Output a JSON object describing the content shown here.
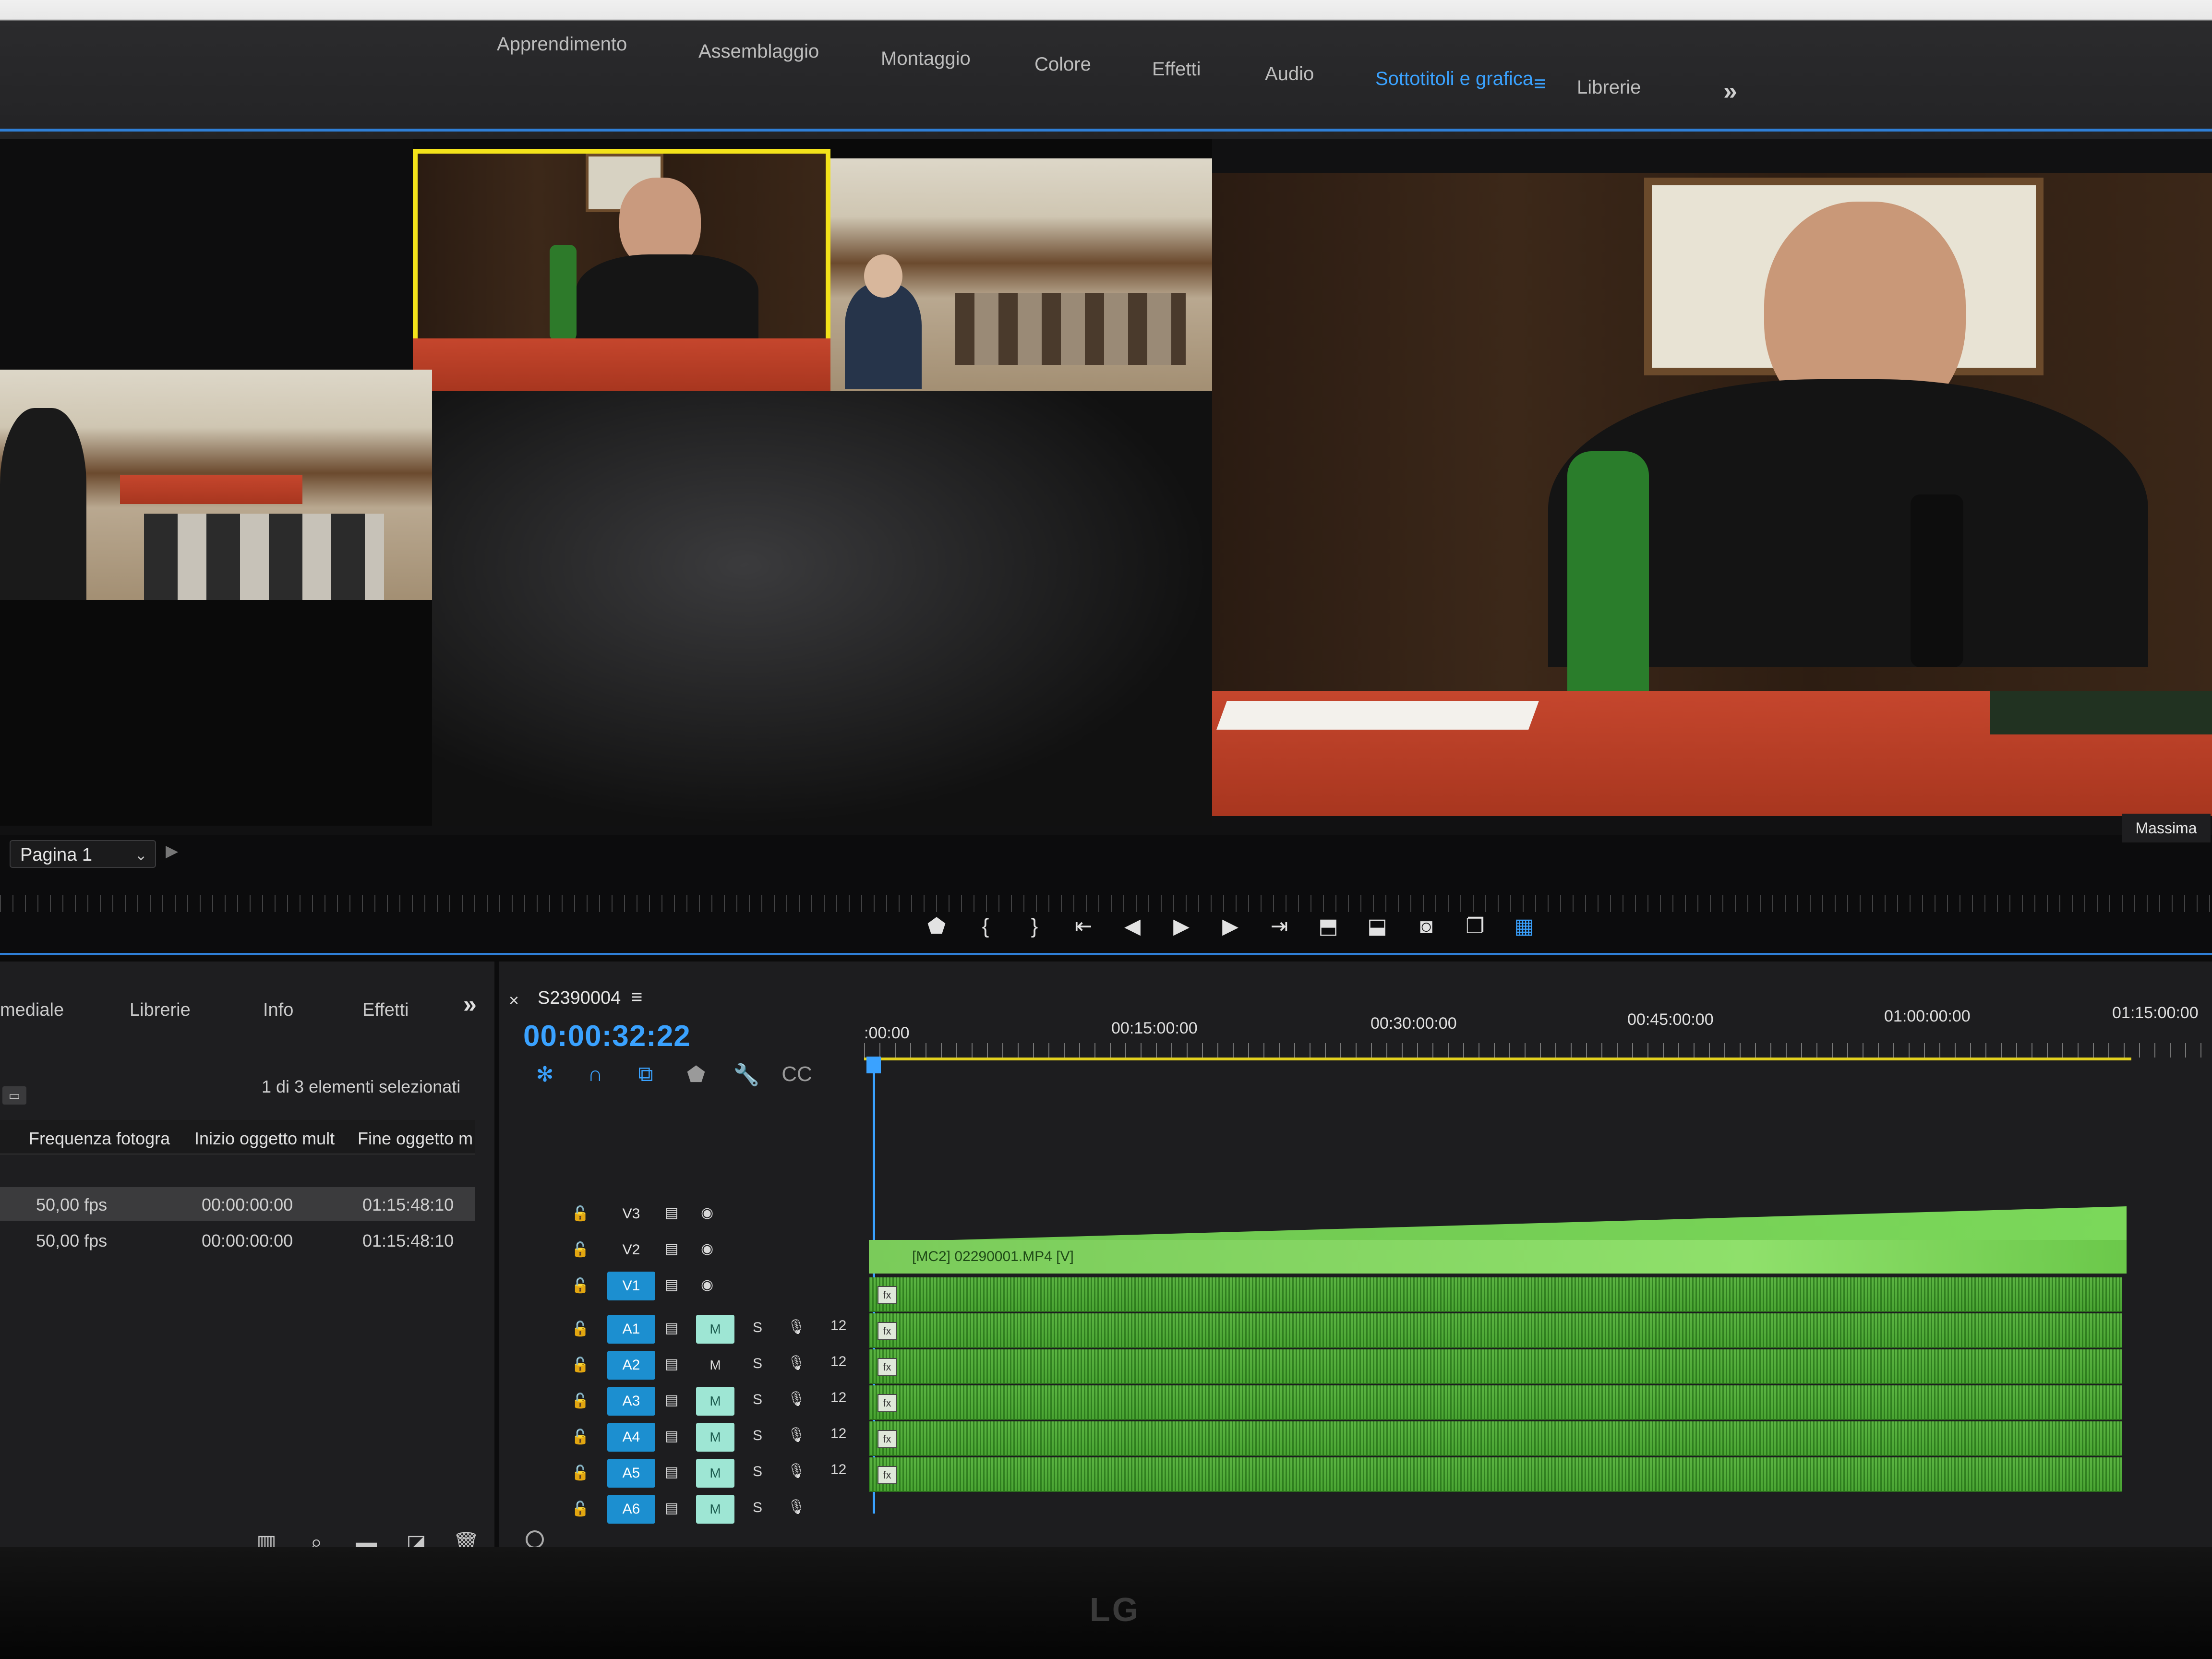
{
  "workspaces": {
    "tabs": [
      "Apprendimento",
      "Assemblaggio",
      "Montaggio",
      "Colore",
      "Effetti",
      "Audio",
      "Sottotitoli e grafica",
      "Librerie"
    ],
    "active": "Sottotitoli e grafica",
    "menu_icon": "hamburger-icon",
    "overflow_icon": "double-chevron-right-icon"
  },
  "monitor": {
    "page_select": "Pagina 1",
    "zoom": "Massima",
    "selected_camera": 2,
    "transport_icons": [
      "marker-icon",
      "mark-in-icon",
      "mark-out-icon",
      "go-to-in-icon",
      "step-back-icon",
      "play-icon",
      "step-forward-icon",
      "go-to-out-icon",
      "lift-icon",
      "extract-icon",
      "export-frame-icon",
      "comparison-view-icon",
      "multicam-icon"
    ]
  },
  "project_panel": {
    "tabs": [
      "mediale",
      "Librerie",
      "Info",
      "Effetti"
    ],
    "selection": "1 di 3 elementi selezionati",
    "columns": [
      "Frequenza fotogra",
      "Inizio oggetto mult",
      "Fine oggetto m"
    ],
    "rows": [
      {
        "fps": "50,00 fps",
        "start": "00:00:00:00",
        "end": "01:15:48:10",
        "selected": true
      },
      {
        "fps": "50,00 fps",
        "start": "00:00:00:00",
        "end": "01:15:48:10",
        "selected": false
      }
    ],
    "tool_icons": [
      "freeform-icon",
      "search-icon",
      "folder-icon",
      "new-item-icon",
      "trash-icon"
    ]
  },
  "timeline": {
    "close": "×",
    "sequence_name": "S2390004",
    "menu": "≡",
    "timecode": "00:00:32:22",
    "ruler_labels": [
      ":00:00",
      "00:15:00:00",
      "00:30:00:00",
      "00:45:00:00",
      "01:00:00:00",
      "01:15:00:00"
    ],
    "video_tracks": [
      "V3",
      "V2",
      "V1"
    ],
    "audio_tracks": [
      "A1",
      "A2",
      "A3",
      "A4",
      "A5",
      "A6"
    ],
    "solo_label": "S",
    "mute_label": "M",
    "audio_level": "12",
    "video_clip": "[MC2] 02290001.MP4 [V]",
    "playhead_fraction": 0.007
  },
  "bezel": {
    "brand": "LG"
  }
}
